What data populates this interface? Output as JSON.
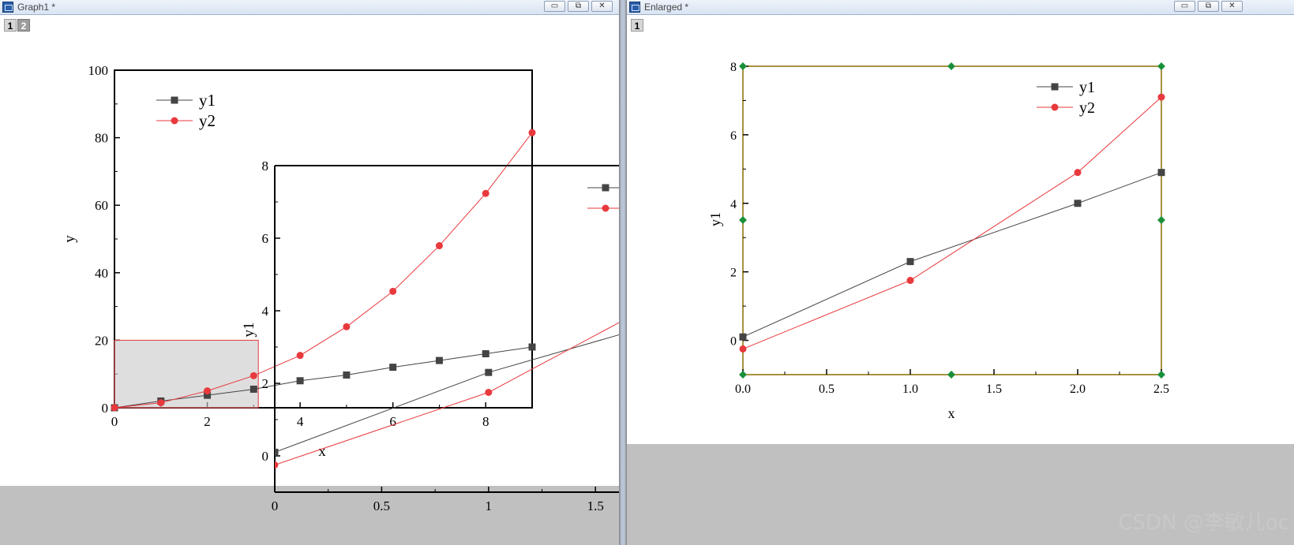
{
  "windows": {
    "left_title": "Graph1 *",
    "right_title": "Enlarged *",
    "left_layers": [
      "1",
      "2"
    ],
    "right_layers": [
      "1"
    ],
    "window_buttons": [
      "▭",
      "⧉",
      "✕"
    ]
  },
  "watermark": "CSDN @李敏儿oc",
  "chart_data": [
    {
      "type": "line",
      "ylabel": "y",
      "xlabel": "",
      "xlim": [
        0,
        9
      ],
      "ylim": [
        0,
        100
      ],
      "x_ticks": [
        0,
        2,
        4,
        6,
        8
      ],
      "y_ticks": [
        0,
        20,
        40,
        60,
        80,
        100
      ],
      "legend": "top-left",
      "series": [
        {
          "name": "y1",
          "color": "#444444",
          "marker": "square",
          "x": [
            0,
            1,
            2,
            3,
            4,
            5,
            6,
            7,
            8,
            9
          ],
          "y": [
            0,
            2,
            3.7,
            5.5,
            8,
            9.7,
            12,
            14,
            16,
            18
          ]
        },
        {
          "name": "y2",
          "color": "#e8393d",
          "marker": "circle",
          "x": [
            0,
            1,
            2,
            3,
            4,
            5,
            6,
            7,
            8,
            9
          ],
          "y": [
            0,
            1.5,
            5,
            9.5,
            15.5,
            24,
            34.5,
            48,
            63.5,
            81.5
          ]
        }
      ],
      "zoom_region": {
        "x": [
          0,
          3.1
        ],
        "y": [
          0,
          20
        ]
      }
    },
    {
      "type": "line",
      "xlabel": "x",
      "ylabel": "y1",
      "xlim": [
        0,
        2.5
      ],
      "ylim": [
        -1,
        8
      ],
      "x_ticks": [
        0.0,
        0.5,
        1.0,
        1.5
      ],
      "y_ticks": [
        0,
        2,
        4,
        6,
        8
      ],
      "legend": "top-right",
      "series": [
        {
          "name": "y1",
          "color": "#444444",
          "marker": "square",
          "x": [
            0,
            1,
            2,
            2.5
          ],
          "y": [
            0.1,
            2.3,
            4.0,
            4.9
          ]
        },
        {
          "name": "y2",
          "color": "#e8393d",
          "marker": "circle",
          "x": [
            0,
            1,
            2,
            2.5
          ],
          "y": [
            -0.25,
            1.75,
            4.9,
            7.1
          ]
        }
      ]
    },
    {
      "type": "line",
      "xlabel": "x",
      "ylabel": "y1",
      "xlim": [
        0,
        2.5
      ],
      "ylim": [
        -1,
        8
      ],
      "x_ticks": [
        "0.0",
        "0.5",
        "1.0",
        "1.5",
        "2.0",
        "2.5"
      ],
      "y_ticks": [
        0,
        2,
        4,
        6,
        8
      ],
      "legend": "top-right",
      "series": [
        {
          "name": "y1",
          "color": "#444444",
          "marker": "square",
          "x": [
            0,
            1,
            2,
            2.5
          ],
          "y": [
            0.1,
            2.3,
            4.0,
            4.9
          ]
        },
        {
          "name": "y2",
          "color": "#e8393d",
          "marker": "circle",
          "x": [
            0,
            1,
            2,
            2.5
          ],
          "y": [
            -0.25,
            1.75,
            4.9,
            7.1
          ]
        }
      ]
    }
  ]
}
